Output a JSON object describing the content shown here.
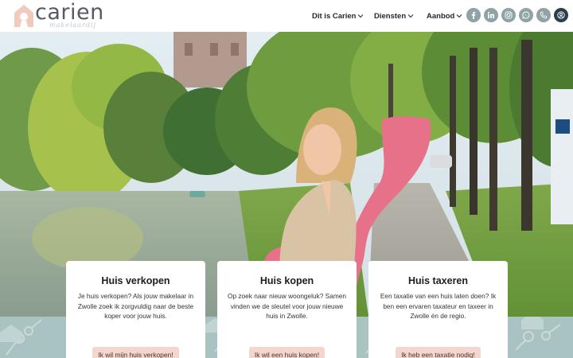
{
  "brand": {
    "name": "carien",
    "tagline": "makelaardij"
  },
  "nav": [
    {
      "label": "Dit is Carien"
    },
    {
      "label": "Diensten"
    },
    {
      "label": "Aanbod"
    }
  ],
  "socials": [
    "facebook-icon",
    "linkedin-icon",
    "instagram-icon",
    "whatsapp-icon",
    "phone-icon",
    "account-icon"
  ],
  "colors": {
    "accent_teal": "#8fa2a6",
    "button_bg": "#f3d6cd",
    "key_pink": "#e8718a",
    "pattern_bg": "#a9c3c3"
  },
  "cards": [
    {
      "title": "Huis verkopen",
      "text": "Je huis verkopen? Als jouw makelaar in Zwolle zoek ik zorgvuldig naar de beste koper voor jouw huis.",
      "button": "Ik wil mijn huis verkopen!"
    },
    {
      "title": "Huis kopen",
      "text": "Op zoek naar nieuw woongeluk? Samen vinden we de sleutel voor jouw nieuwe huis in Zwolle.",
      "button": "Ik wil een huis kopen!"
    },
    {
      "title": "Huis taxeren",
      "text": "Een taxatie van een huis laten doen? Ik ben een ervaren taxateur en taxeer in Zwolle én de regio.",
      "button": "Ik heb een taxatie nodig!"
    }
  ]
}
